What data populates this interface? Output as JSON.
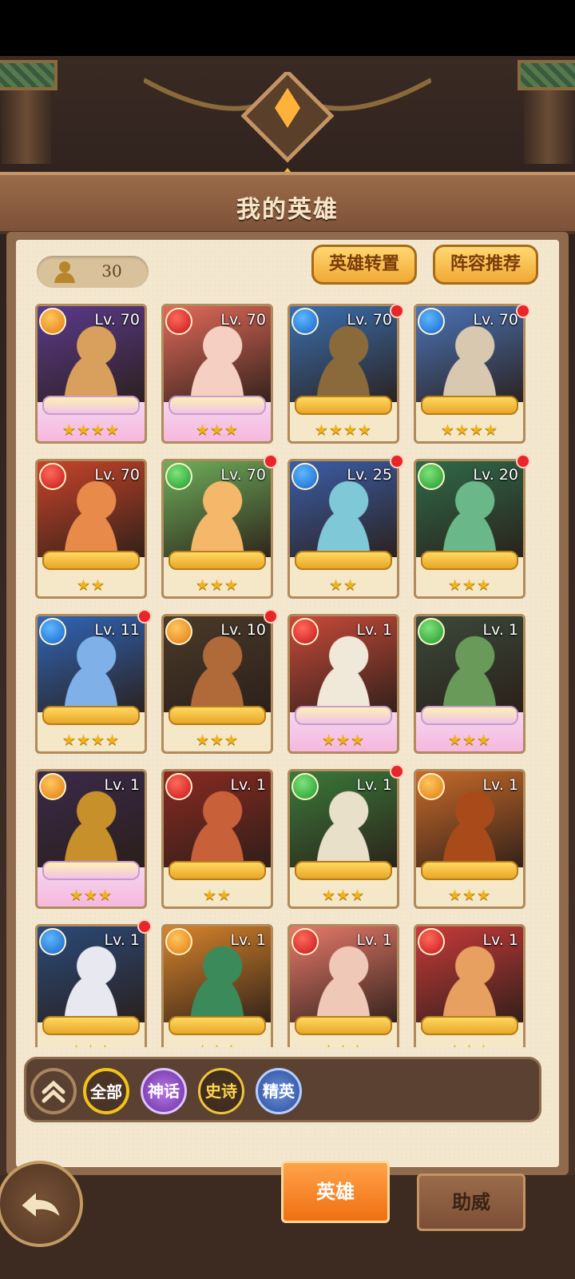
{
  "header": {
    "title": "我的英雄"
  },
  "toolbar": {
    "hero_count": "30",
    "transfer_label": "英雄转置",
    "recommend_label": "阵容推荐"
  },
  "heroes": [
    {
      "level": "Lv. 70",
      "element": "earth",
      "stars": "★★★★",
      "rarity": "mythic",
      "notification": false,
      "palette": [
        "#5b3a8c",
        "#d8a05c"
      ]
    },
    {
      "level": "Lv. 70",
      "element": "fire",
      "stars": "★★★",
      "rarity": "mythic",
      "notification": false,
      "palette": [
        "#e26a5a",
        "#f5d0c2"
      ]
    },
    {
      "level": "Lv. 70",
      "element": "water",
      "stars": "★★★★",
      "rarity": "epic",
      "notification": true,
      "palette": [
        "#3a6fb0",
        "#8a6a3a"
      ]
    },
    {
      "level": "Lv. 70",
      "element": "water",
      "stars": "★★★★",
      "rarity": "epic",
      "notification": true,
      "palette": [
        "#4a74b8",
        "#d8c8b0"
      ]
    },
    {
      "level": "Lv. 70",
      "element": "fire",
      "stars": "★★",
      "rarity": "epic",
      "notification": false,
      "palette": [
        "#c8442a",
        "#e88a4a"
      ]
    },
    {
      "level": "Lv. 70",
      "element": "nature",
      "stars": "★★★",
      "rarity": "epic",
      "notification": true,
      "palette": [
        "#6fae5a",
        "#f5b86a"
      ]
    },
    {
      "level": "Lv. 25",
      "element": "water",
      "stars": "★★",
      "rarity": "epic",
      "notification": true,
      "palette": [
        "#3b5ea8",
        "#7fc8d8"
      ]
    },
    {
      "level": "Lv. 20",
      "element": "nature",
      "stars": "★★★",
      "rarity": "epic",
      "notification": true,
      "palette": [
        "#2f6a4a",
        "#6ab88a"
      ]
    },
    {
      "level": "Lv. 11",
      "element": "water",
      "stars": "★★★★",
      "rarity": "epic",
      "notification": true,
      "palette": [
        "#2f66b8",
        "#7fb0e8"
      ]
    },
    {
      "level": "Lv. 10",
      "element": "earth",
      "stars": "★★★",
      "rarity": "epic",
      "notification": true,
      "palette": [
        "#4a3a2a",
        "#b06a3a"
      ]
    },
    {
      "level": "Lv. 1",
      "element": "fire",
      "stars": "★★★",
      "rarity": "mythic",
      "notification": false,
      "palette": [
        "#c84a3a",
        "#f0e8d8"
      ]
    },
    {
      "level": "Lv. 1",
      "element": "nature",
      "stars": "★★★",
      "rarity": "mythic",
      "notification": false,
      "palette": [
        "#3a4a3a",
        "#6a9a5a"
      ]
    },
    {
      "level": "Lv. 1",
      "element": "earth",
      "stars": "★★★",
      "rarity": "mythic",
      "notification": false,
      "palette": [
        "#3a2a4a",
        "#c8902a"
      ]
    },
    {
      "level": "Lv. 1",
      "element": "fire",
      "stars": "★★",
      "rarity": "epic",
      "notification": false,
      "palette": [
        "#8a2a22",
        "#c8603a"
      ]
    },
    {
      "level": "Lv. 1",
      "element": "nature",
      "stars": "★★★",
      "rarity": "epic",
      "notification": true,
      "palette": [
        "#3a7a3a",
        "#e8e0c8"
      ]
    },
    {
      "level": "Lv. 1",
      "element": "earth",
      "stars": "★★★",
      "rarity": "epic",
      "notification": false,
      "palette": [
        "#c86a2a",
        "#a84a1a"
      ]
    },
    {
      "level": "Lv. 1",
      "element": "water",
      "stars": "★★★",
      "rarity": "epic",
      "notification": true,
      "palette": [
        "#2a4a7a",
        "#e8e8f0"
      ]
    },
    {
      "level": "Lv. 1",
      "element": "earth",
      "stars": "★★★",
      "rarity": "epic",
      "notification": false,
      "palette": [
        "#d8842a",
        "#3a8a5a"
      ]
    },
    {
      "level": "Lv. 1",
      "element": "fire",
      "stars": "★★★",
      "rarity": "epic",
      "notification": false,
      "palette": [
        "#e87a6a",
        "#f0c8b8"
      ]
    },
    {
      "level": "Lv. 1",
      "element": "fire",
      "stars": "★★★",
      "rarity": "epic",
      "notification": false,
      "palette": [
        "#c83a3a",
        "#e8a060"
      ]
    }
  ],
  "filters": {
    "all": "全部",
    "mythic": "神话",
    "epic": "史诗",
    "elite": "精英"
  },
  "tabs": {
    "heroes": "英雄",
    "support": "助威"
  },
  "colors": {
    "accent": "#f06f12",
    "badge": "#e8262a",
    "star": "#f0b21a"
  }
}
